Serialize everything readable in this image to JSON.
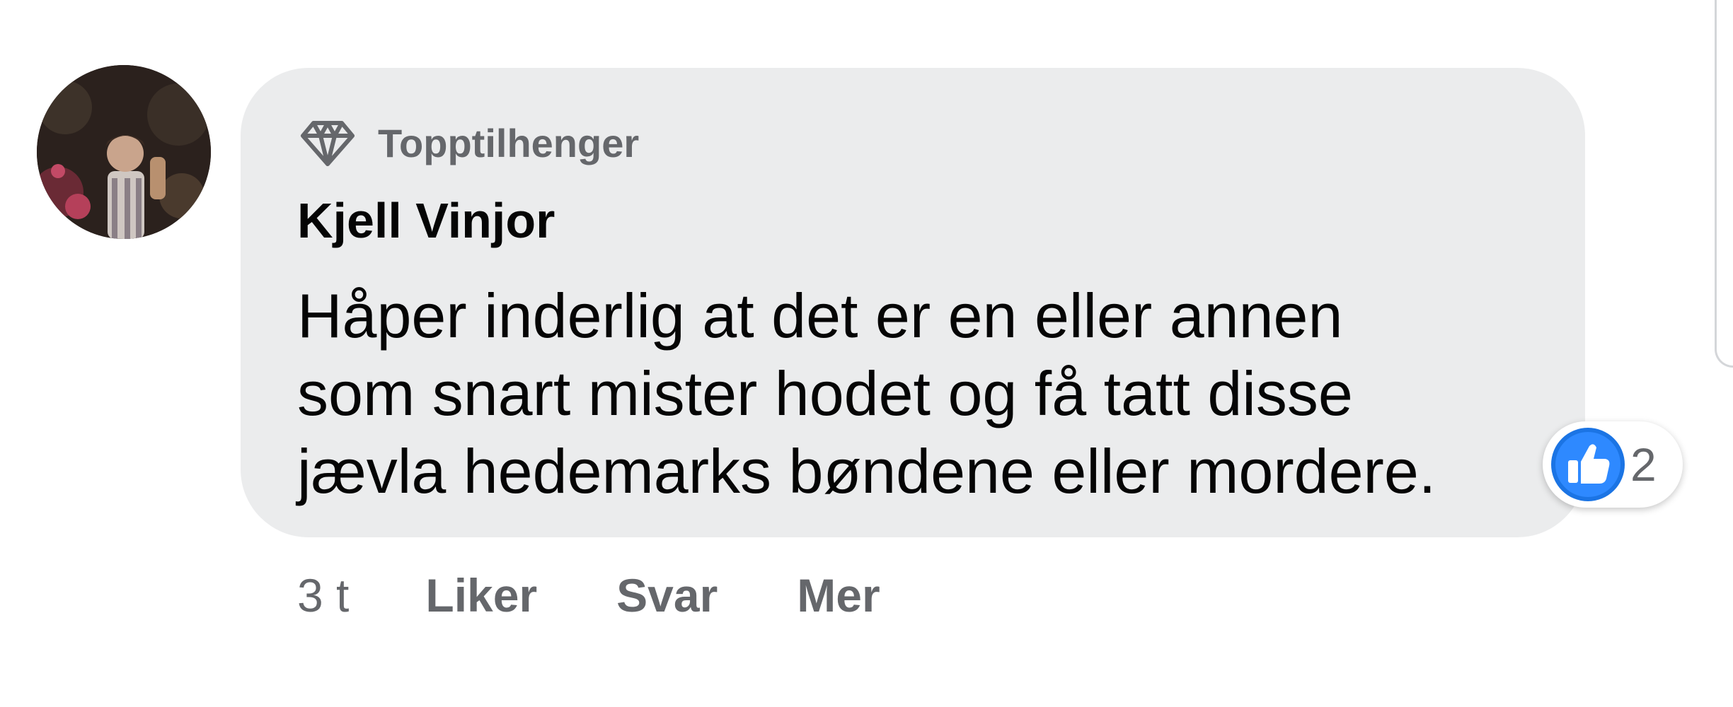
{
  "comment": {
    "badge": {
      "icon": "diamond-icon",
      "label": "Topptilhenger"
    },
    "author": "Kjell Vinjor",
    "text_lines": [
      "Håper inderlig at det er en eller annen",
      "som snart mister hodet og få tatt disse",
      "jævla hedemarks bøndene eller mordere."
    ],
    "reactions": {
      "icon": "like-icon",
      "count": "2",
      "color": "#1b74e4"
    },
    "actions": {
      "timestamp": "3 t",
      "like_label": "Liker",
      "reply_label": "Svar",
      "more_label": "Mer"
    }
  },
  "colors": {
    "bubble_background": "#ebeced",
    "secondary_text": "#65676b",
    "primary_text": "#050505"
  }
}
